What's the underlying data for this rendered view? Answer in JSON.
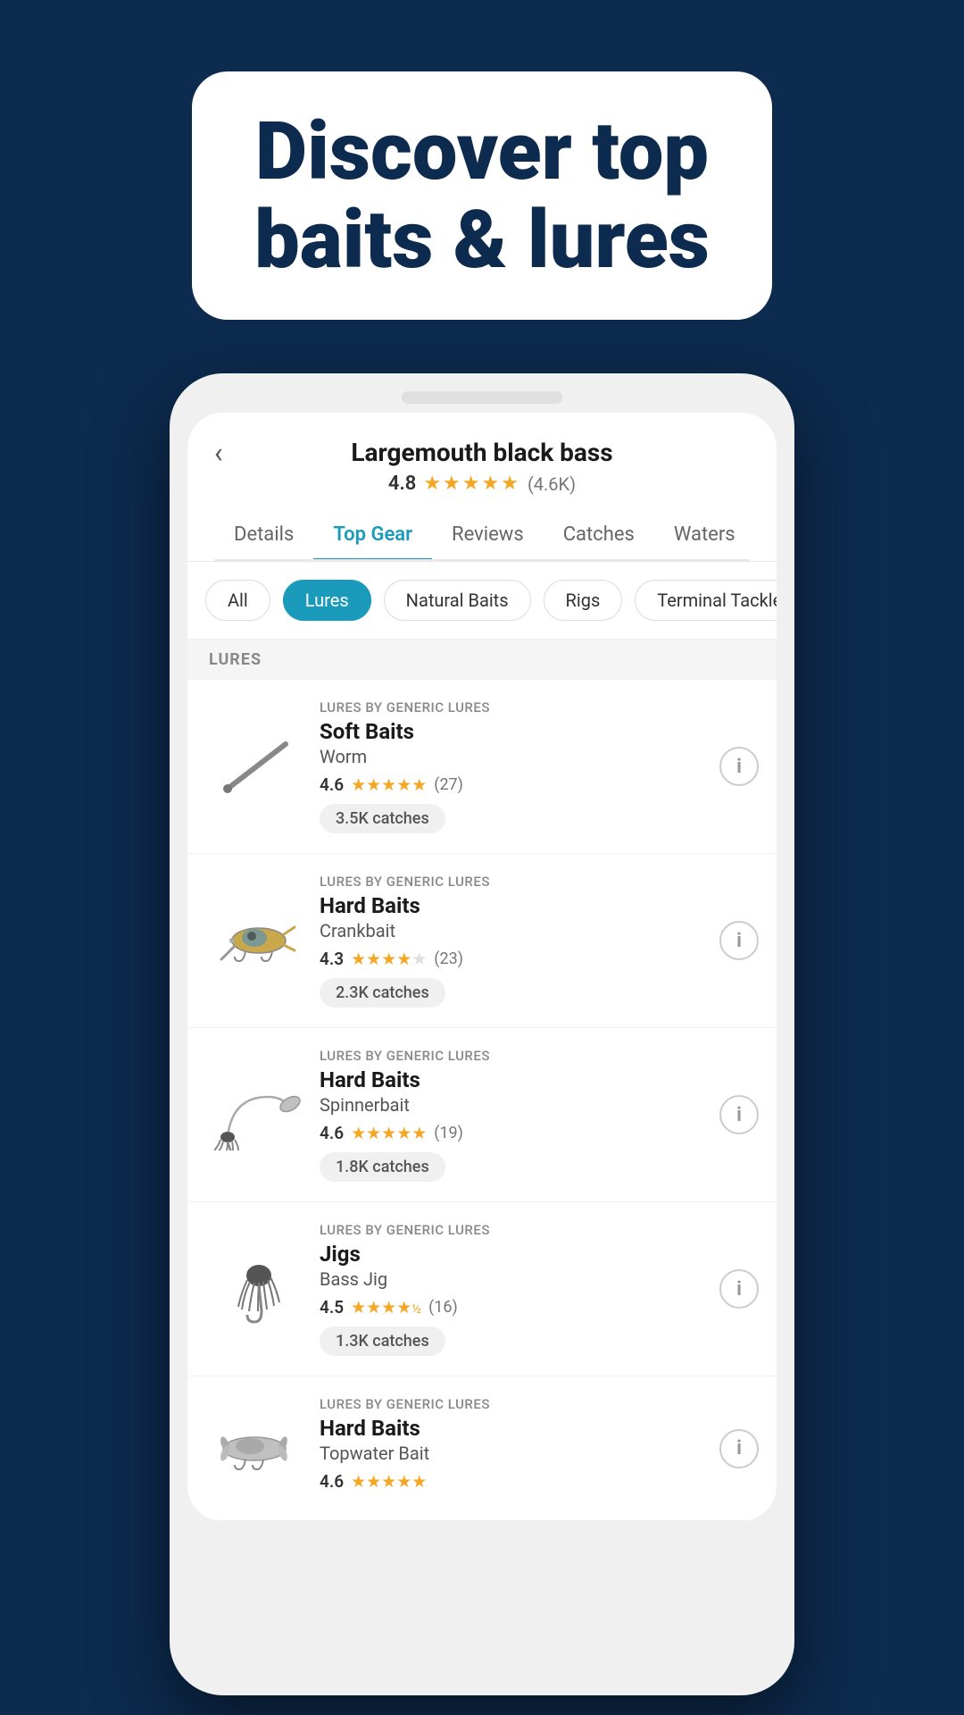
{
  "hero": {
    "title_line1": "Discover top",
    "title_line2": "baits & lures"
  },
  "phone": {
    "header": {
      "fish_name": "Largemouth black bass",
      "rating": "4.8",
      "rating_count": "(4.6K)",
      "back_icon": "‹"
    },
    "nav_tabs": [
      {
        "label": "Details",
        "active": false
      },
      {
        "label": "Top Gear",
        "active": true
      },
      {
        "label": "Reviews",
        "active": false
      },
      {
        "label": "Catches",
        "active": false
      },
      {
        "label": "Waters",
        "active": false
      }
    ],
    "filter_chips": [
      {
        "label": "All",
        "active": false
      },
      {
        "label": "Lures",
        "active": true
      },
      {
        "label": "Natural Baits",
        "active": false
      },
      {
        "label": "Rigs",
        "active": false
      },
      {
        "label": "Terminal Tackle",
        "active": false
      }
    ],
    "section_label": "LURES",
    "lures": [
      {
        "category": "LURES BY GENERIC LURES",
        "name": "Soft Baits",
        "subcategory": "Worm",
        "rating": "4.6",
        "review_count": "(27)",
        "catches": "3.5K catches",
        "image_type": "worm"
      },
      {
        "category": "LURES BY GENERIC LURES",
        "name": "Hard Baits",
        "subcategory": "Crankbait",
        "rating": "4.3",
        "review_count": "(23)",
        "catches": "2.3K catches",
        "image_type": "crankbait"
      },
      {
        "category": "LURES BY GENERIC LURES",
        "name": "Hard Baits",
        "subcategory": "Spinnerbait",
        "rating": "4.6",
        "review_count": "(19)",
        "catches": "1.8K catches",
        "image_type": "spinnerbait"
      },
      {
        "category": "LURES BY GENERIC LURES",
        "name": "Jigs",
        "subcategory": "Bass Jig",
        "rating": "4.5",
        "review_count": "(16)",
        "catches": "1.3K catches",
        "image_type": "jig"
      },
      {
        "category": "LURES BY GENERIC LURES",
        "name": "Hard Baits",
        "subcategory": "Topwater Bait",
        "rating": "4.6",
        "review_count": "",
        "catches": "",
        "image_type": "topwater"
      }
    ],
    "stars_full": "★★★★★",
    "stars_4_3": "★★★★½",
    "stars_4_5": "★★★★½"
  }
}
